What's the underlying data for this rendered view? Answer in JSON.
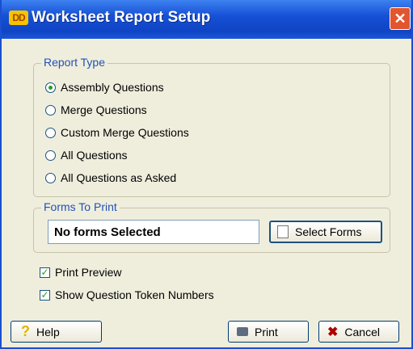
{
  "window": {
    "title": "Worksheet Report Setup",
    "app_icon": "DD",
    "close_glyph": "✕"
  },
  "report_type": {
    "legend": "Report Type",
    "options": [
      {
        "label": "Assembly Questions",
        "selected": true
      },
      {
        "label": "Merge Questions",
        "selected": false
      },
      {
        "label": "Custom Merge Questions",
        "selected": false
      },
      {
        "label": "All Questions",
        "selected": false
      },
      {
        "label": "All Questions as Asked",
        "selected": false
      }
    ]
  },
  "forms_to_print": {
    "legend": "Forms To Print",
    "value": "No forms Selected",
    "select_button": "Select Forms",
    "select_icon": "form-icon"
  },
  "options": [
    {
      "label": "Print Preview",
      "checked": true
    },
    {
      "label": "Show Question Token Numbers",
      "checked": true
    }
  ],
  "buttons": {
    "help": "Help",
    "print": "Print",
    "cancel": "Cancel"
  },
  "colors": {
    "accent": "#2150b8",
    "titlebar": "#1751d6",
    "close": "#e2562f",
    "check": "#21a121"
  }
}
